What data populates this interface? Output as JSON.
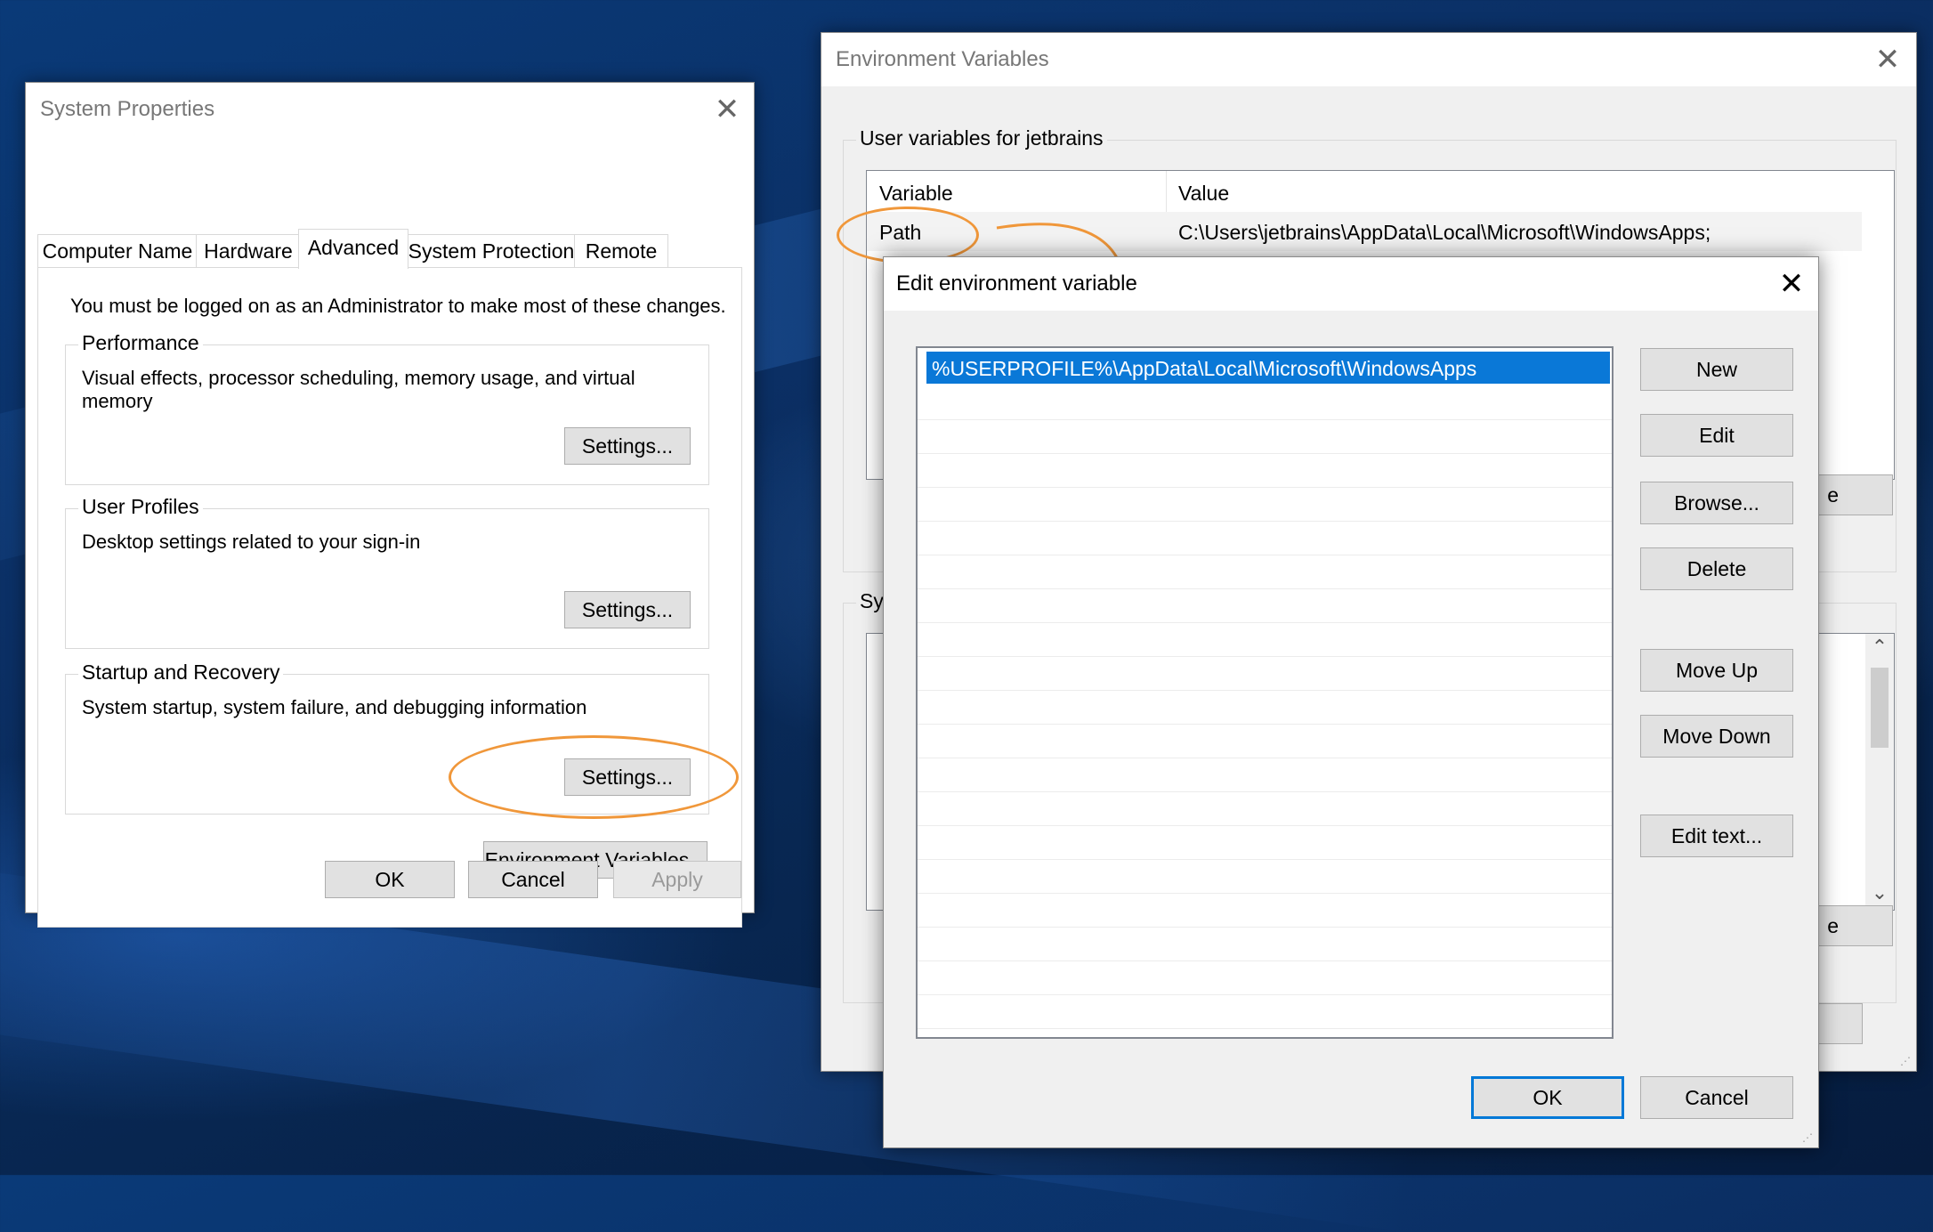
{
  "colors": {
    "accent": "#0078d7",
    "annotation": "#f0973a",
    "selection": "#0a78d7"
  },
  "system_properties": {
    "title": "System Properties",
    "tabs": [
      {
        "label": "Computer Name"
      },
      {
        "label": "Hardware"
      },
      {
        "label": "Advanced"
      },
      {
        "label": "System Protection"
      },
      {
        "label": "Remote"
      }
    ],
    "admin_note": "You must be logged on as an Administrator to make most of these changes.",
    "performance": {
      "label": "Performance",
      "desc": "Visual effects, processor scheduling, memory usage, and virtual memory",
      "settings": "Settings..."
    },
    "user_profiles": {
      "label": "User Profiles",
      "desc": "Desktop settings related to your sign-in",
      "settings": "Settings..."
    },
    "startup": {
      "label": "Startup and Recovery",
      "desc": "System startup, system failure, and debugging information",
      "settings": "Settings..."
    },
    "env_button": "Environment Variables...",
    "ok": "OK",
    "cancel": "Cancel",
    "apply": "Apply"
  },
  "env_vars": {
    "title": "Environment Variables",
    "user_section": "User variables for jetbrains",
    "col_variable": "Variable",
    "col_value": "Value",
    "rows": [
      {
        "variable": "Path",
        "value": "C:\\Users\\jetbrains\\AppData\\Local\\Microsoft\\WindowsApps;"
      }
    ],
    "system_section_fragment": "Sy",
    "btn_fragment_1": "e",
    "btn_fragment_2": "e"
  },
  "edit_env": {
    "title": "Edit environment variable",
    "entries": [
      "%USERPROFILE%\\AppData\\Local\\Microsoft\\WindowsApps"
    ],
    "buttons": {
      "new": "New",
      "edit": "Edit",
      "browse": "Browse...",
      "delete": "Delete",
      "move_up": "Move Up",
      "move_down": "Move Down",
      "edit_text": "Edit text...",
      "ok": "OK",
      "cancel": "Cancel"
    }
  }
}
